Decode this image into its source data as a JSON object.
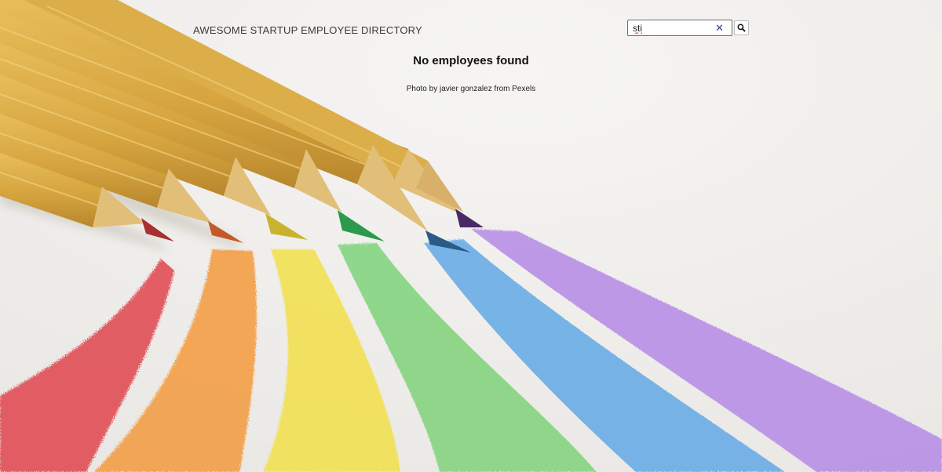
{
  "header": {
    "title": "AWESOME STARTUP EMPLOYEE DIRECTORY"
  },
  "search": {
    "value": "sti",
    "clear_icon": "close-icon",
    "button_icon": "search-icon"
  },
  "results": {
    "message": "No employees found"
  },
  "credit": "Photo by javier gonzalez from Pexels",
  "colors": {
    "background": "#f2f1ef",
    "pencil_wood": "#d9a944",
    "strokes": [
      "#e0454d",
      "#f39a3e",
      "#f3e048",
      "#7fd37a",
      "#62a9e6",
      "#b58ae6"
    ],
    "clear_icon": "#2b3d8f"
  }
}
